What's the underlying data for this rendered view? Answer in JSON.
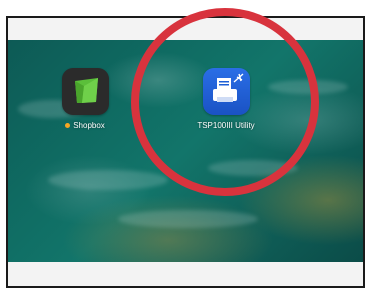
{
  "apps": [
    {
      "name": "Shopbox",
      "icon": "shopbox-icon",
      "icon_bg": "#2b2b2b",
      "icon_fg": "#5bbf3a",
      "badge_color": "#f5a623"
    },
    {
      "name": "TSP100III Utility",
      "icon": "printer-icon",
      "icon_bg": "#1d5fd6"
    }
  ],
  "annotation": {
    "shape": "highlight-circle",
    "color": "#d8333d"
  }
}
